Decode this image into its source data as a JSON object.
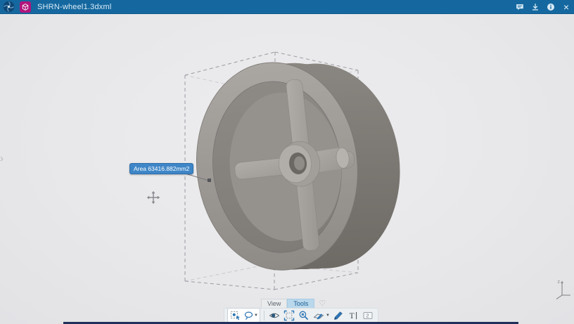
{
  "window": {
    "title": "SHRN-wheel1.3dxml",
    "brand_icon": "compass-icon",
    "app_icon": "3d-cube-app-icon",
    "actions": [
      {
        "name": "comment"
      },
      {
        "name": "download"
      },
      {
        "name": "info"
      },
      {
        "name": "close",
        "glyph": "×"
      }
    ]
  },
  "viewport": {
    "model": "wheel-3d-model",
    "measurement_label": "Area 63416.882mm2",
    "cursor": "move-cursor",
    "expander": "panel-expander-chevron",
    "axis_label": "z"
  },
  "toolbar": {
    "tabs": [
      {
        "label": "View",
        "active": false
      },
      {
        "label": "Tools",
        "active": true
      }
    ],
    "favorite_icon": "heart-icon",
    "tools": [
      "select-tool",
      "lasso-select-tool",
      "hide-show-tool",
      "fit-view-tool",
      "zoom-area-tool",
      "section-tool",
      "ink-annotation-tool",
      "text-annotation-tool",
      "note-2d-tool"
    ]
  },
  "colors": {
    "titlebar": "#15689f",
    "app_icon_bg": "#b1167c",
    "label_bg": "#3e86c7",
    "canvas_bg": "#e9e9eb",
    "tab_active_bg": "#b9d8ec"
  }
}
